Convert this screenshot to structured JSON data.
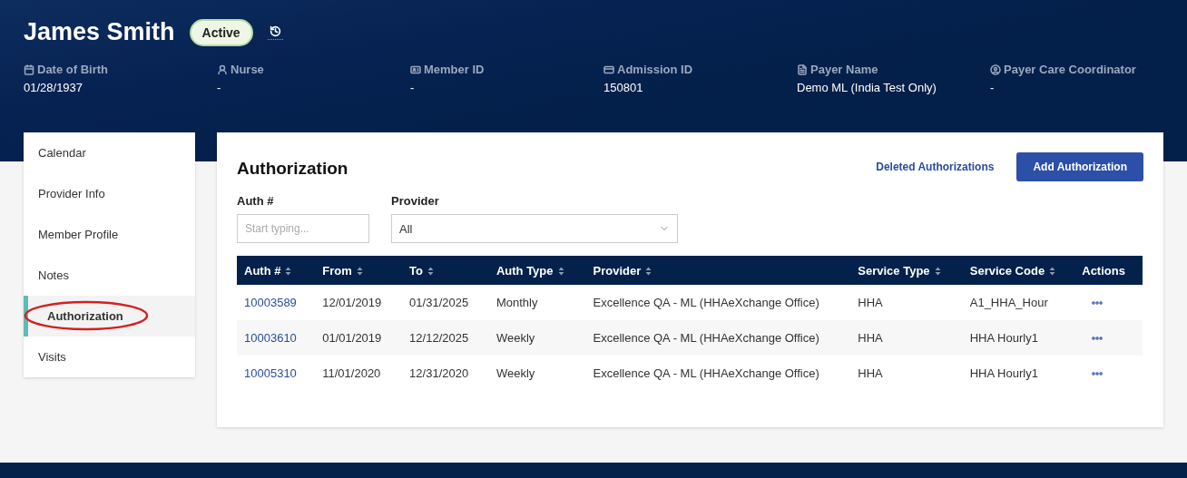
{
  "member": {
    "name": "James Smith",
    "status": "Active"
  },
  "info": [
    {
      "kind": "calendar",
      "label": "Date of Birth",
      "value": "01/28/1937"
    },
    {
      "kind": "person",
      "label": "Nurse",
      "value": "-"
    },
    {
      "kind": "badge",
      "label": "Member ID",
      "value": "-"
    },
    {
      "kind": "card",
      "label": "Admission ID",
      "value": "150801"
    },
    {
      "kind": "file",
      "label": "Payer Name",
      "value": "Demo ML (India Test Only)"
    },
    {
      "kind": "user-circle",
      "label": "Payer Care Coordinator",
      "value": "-"
    }
  ],
  "sidebar": {
    "items": [
      {
        "label": "Calendar",
        "selected": false,
        "circled": false
      },
      {
        "label": "Provider Info",
        "selected": false,
        "circled": false
      },
      {
        "label": "Member Profile",
        "selected": false,
        "circled": false
      },
      {
        "label": "Notes",
        "selected": false,
        "circled": false
      },
      {
        "label": "Authorization",
        "selected": true,
        "circled": true
      },
      {
        "label": "Visits",
        "selected": false,
        "circled": false
      }
    ]
  },
  "panel": {
    "title": "Authorization",
    "link": "Deleted Authorizations",
    "button": "Add Authorization",
    "filters": [
      {
        "kind": "text",
        "label": "Auth #",
        "placeholder": "Start typing..."
      },
      {
        "kind": "select",
        "label": "Provider",
        "value": "All"
      }
    ]
  },
  "table": {
    "columns": [
      {
        "label": "Auth #",
        "sortable": true
      },
      {
        "label": "From",
        "sortable": true
      },
      {
        "label": "To",
        "sortable": true
      },
      {
        "label": "Auth Type",
        "sortable": true
      },
      {
        "label": "Provider",
        "sortable": true
      },
      {
        "label": "Service Type",
        "sortable": true
      },
      {
        "label": "Service Code",
        "sortable": true
      },
      {
        "label": "Actions",
        "sortable": false
      }
    ],
    "rows": [
      [
        "10003589",
        "12/01/2019",
        "01/31/2025",
        "Monthly",
        "Excellence QA - ML (HHAeXchange Office)",
        "HHA",
        "A1_HHA_Hour"
      ],
      [
        "10003610",
        "01/01/2019",
        "12/12/2025",
        "Weekly",
        "Excellence QA - ML (HHAeXchange Office)",
        "HHA",
        "HHA Hourly1"
      ],
      [
        "10005310",
        "11/01/2020",
        "12/31/2020",
        "Weekly",
        "Excellence QA - ML (HHAeXchange Office)",
        "HHA",
        "HHA Hourly1"
      ]
    ]
  }
}
